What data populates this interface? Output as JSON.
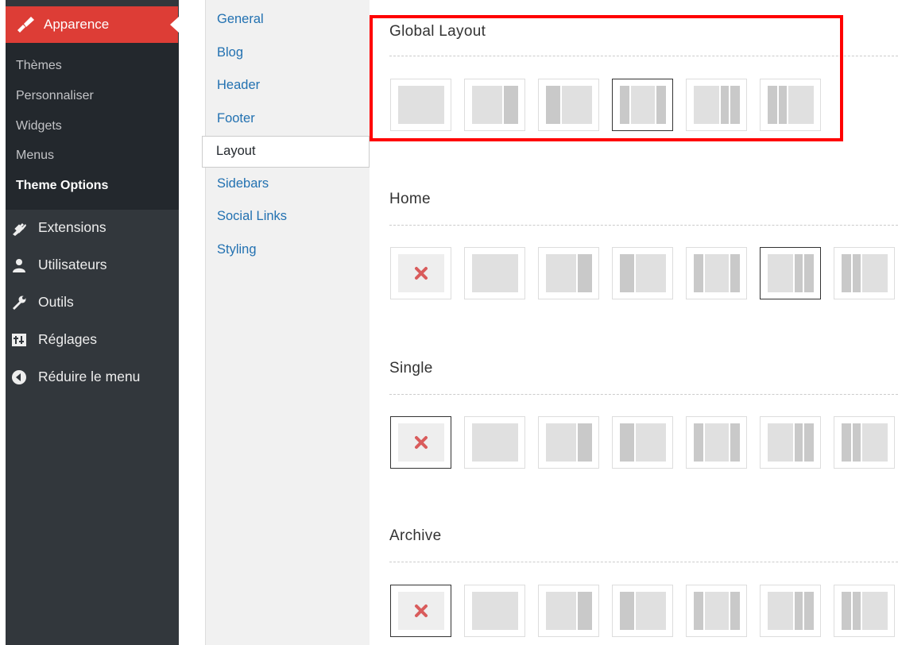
{
  "sidebar": {
    "header": {
      "label": "Apparence",
      "icon": "paintbrush-icon"
    },
    "submenu": [
      {
        "label": "Thèmes"
      },
      {
        "label": "Personnaliser"
      },
      {
        "label": "Widgets"
      },
      {
        "label": "Menus"
      },
      {
        "label": "Theme Options",
        "current": true
      }
    ],
    "main_items": [
      {
        "label": "Extensions",
        "icon": "plug-icon"
      },
      {
        "label": "Utilisateurs",
        "icon": "user-icon"
      },
      {
        "label": "Outils",
        "icon": "wrench-icon"
      },
      {
        "label": "Réglages",
        "icon": "settings-icon"
      },
      {
        "label": "Réduire le menu",
        "icon": "collapse-icon"
      }
    ]
  },
  "tabs": [
    "General",
    "Blog",
    "Header",
    "Footer",
    "Layout",
    "Sidebars",
    "Social Links",
    "Styling"
  ],
  "active_tab": "Layout",
  "sections": [
    {
      "title": "Global Layout",
      "selected_layout": "sidebar-content-sidebar",
      "highlighted": true,
      "options": [
        "full-width",
        "content-sidebar",
        "sidebar-content",
        "sidebar-content-sidebar",
        "content-sidebar-sidebar",
        "sidebar-sidebar-content"
      ]
    },
    {
      "title": "Home",
      "selected_layout": "content-sidebar-sidebar",
      "options": [
        "inherit",
        "full-width",
        "content-sidebar",
        "sidebar-content",
        "sidebar-content-sidebar",
        "content-sidebar-sidebar",
        "sidebar-sidebar-content"
      ]
    },
    {
      "title": "Single",
      "selected_layout": "inherit",
      "options": [
        "inherit",
        "full-width",
        "content-sidebar",
        "sidebar-content",
        "sidebar-content-sidebar",
        "content-sidebar-sidebar",
        "sidebar-sidebar-content"
      ]
    },
    {
      "title": "Archive",
      "selected_layout": "inherit",
      "options": [
        "inherit",
        "full-width",
        "content-sidebar",
        "sidebar-content",
        "sidebar-content-sidebar",
        "content-sidebar-sidebar",
        "sidebar-sidebar-content"
      ]
    }
  ],
  "colors": {
    "accent": "#dd3d36",
    "highlight_box": "#ff0000",
    "link": "#2271b1"
  }
}
